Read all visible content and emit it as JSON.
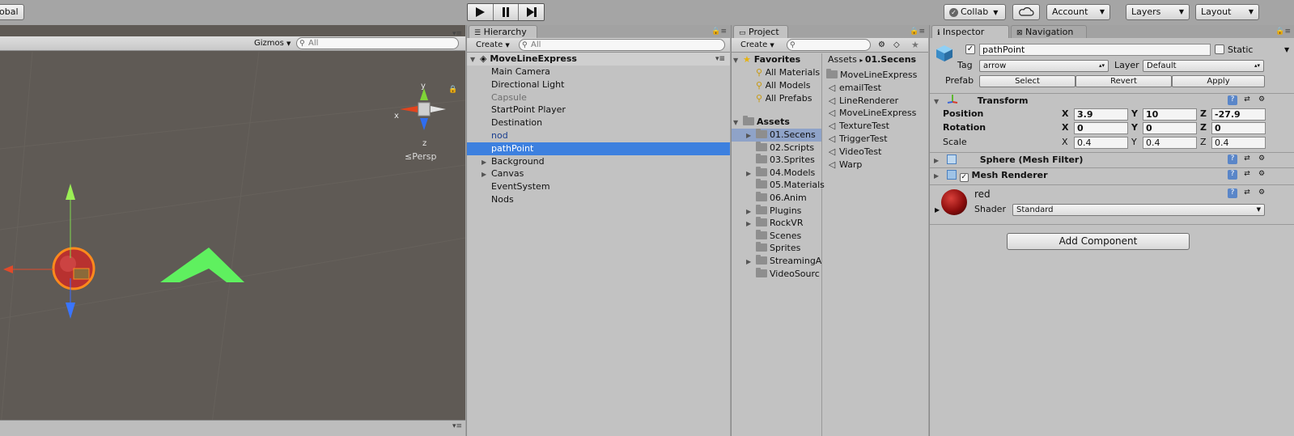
{
  "toolbar": {
    "global_label": "obal",
    "collab_label": "Collab",
    "account_label": "Account",
    "layers_label": "Layers",
    "layout_label": "Layout"
  },
  "scene": {
    "gizmos_label": "Gizmos",
    "search_placeholder": "All",
    "persp_label": "Persp",
    "axis_x": "x",
    "axis_y": "y",
    "axis_z": "z"
  },
  "hierarchy": {
    "tab_label": "Hierarchy",
    "create_label": "Create",
    "search_placeholder": "All",
    "scene_name": "MoveLineExpress",
    "items": [
      {
        "label": "Main Camera",
        "expandable": false,
        "style": "normal"
      },
      {
        "label": "Directional Light",
        "expandable": false,
        "style": "normal"
      },
      {
        "label": "Capsule",
        "expandable": false,
        "style": "disabled"
      },
      {
        "label": "StartPoint Player",
        "expandable": false,
        "style": "normal"
      },
      {
        "label": "Destination",
        "expandable": false,
        "style": "normal"
      },
      {
        "label": "nod",
        "expandable": false,
        "style": "prefab"
      },
      {
        "label": "pathPoint",
        "expandable": false,
        "style": "selected"
      },
      {
        "label": "Background",
        "expandable": true,
        "style": "normal"
      },
      {
        "label": "Canvas",
        "expandable": true,
        "style": "normal"
      },
      {
        "label": "EventSystem",
        "expandable": false,
        "style": "normal"
      },
      {
        "label": "Nods",
        "expandable": false,
        "style": "normal"
      }
    ]
  },
  "project": {
    "tab_label": "Project",
    "create_label": "Create",
    "favorites_label": "Favorites",
    "favorites": [
      "All Materials",
      "All Models",
      "All Prefabs"
    ],
    "assets_label": "Assets",
    "folders": [
      {
        "label": "01.Secens",
        "expandable": true,
        "selected": true
      },
      {
        "label": "02.Scripts",
        "expandable": false,
        "selected": false
      },
      {
        "label": "03.Sprites",
        "expandable": false,
        "selected": false
      },
      {
        "label": "04.Models",
        "expandable": true,
        "selected": false
      },
      {
        "label": "05.Materials",
        "expandable": false,
        "selected": false
      },
      {
        "label": "06.Anim",
        "expandable": false,
        "selected": false
      },
      {
        "label": "Plugins",
        "expandable": true,
        "selected": false
      },
      {
        "label": "RockVR",
        "expandable": true,
        "selected": false
      },
      {
        "label": "Scenes",
        "expandable": false,
        "selected": false
      },
      {
        "label": "Sprites",
        "expandable": false,
        "selected": false
      },
      {
        "label": "StreamingA",
        "expandable": true,
        "selected": false
      },
      {
        "label": "VideoSourc",
        "expandable": false,
        "selected": false
      }
    ],
    "breadcrumb_root": "Assets",
    "breadcrumb_current": "01.Secens",
    "files": [
      {
        "label": "MoveLineExpress",
        "icon": "folder"
      },
      {
        "label": "emailTest",
        "icon": "unity"
      },
      {
        "label": "LineRenderer",
        "icon": "unity"
      },
      {
        "label": "MoveLineExpress",
        "icon": "unity"
      },
      {
        "label": "TextureTest",
        "icon": "unity"
      },
      {
        "label": "TriggerTest",
        "icon": "unity"
      },
      {
        "label": "VideoTest",
        "icon": "unity"
      },
      {
        "label": "Warp",
        "icon": "unity"
      }
    ]
  },
  "inspector": {
    "tab_label": "Inspector",
    "nav_tab_label": "Navigation",
    "object_name": "pathPoint",
    "static_label": "Static",
    "tag_label": "Tag",
    "tag_value": "arrow",
    "layer_label": "Layer",
    "layer_value": "Default",
    "prefab_label": "Prefab",
    "prefab_select": "Select",
    "prefab_revert": "Revert",
    "prefab_apply": "Apply",
    "transform": {
      "title": "Transform",
      "position_label": "Position",
      "rotation_label": "Rotation",
      "scale_label": "Scale",
      "position": {
        "x": "3.9",
        "y": "10",
        "z": "-27.9"
      },
      "rotation": {
        "x": "0",
        "y": "0",
        "z": "0"
      },
      "scale": {
        "x": "0.4",
        "y": "0.4",
        "z": "0.4"
      }
    },
    "axis_x": "X",
    "axis_y": "Y",
    "axis_z": "Z",
    "mesh_filter_title": "Sphere (Mesh Filter)",
    "mesh_renderer_title": "Mesh Renderer",
    "material_name": "red",
    "shader_label": "Shader",
    "shader_value": "Standard",
    "add_component_label": "Add Component"
  },
  "colors": {
    "selection": "#3d80df",
    "scene_bg": "#5f5a55",
    "panel_bg": "#c2c2c2"
  }
}
